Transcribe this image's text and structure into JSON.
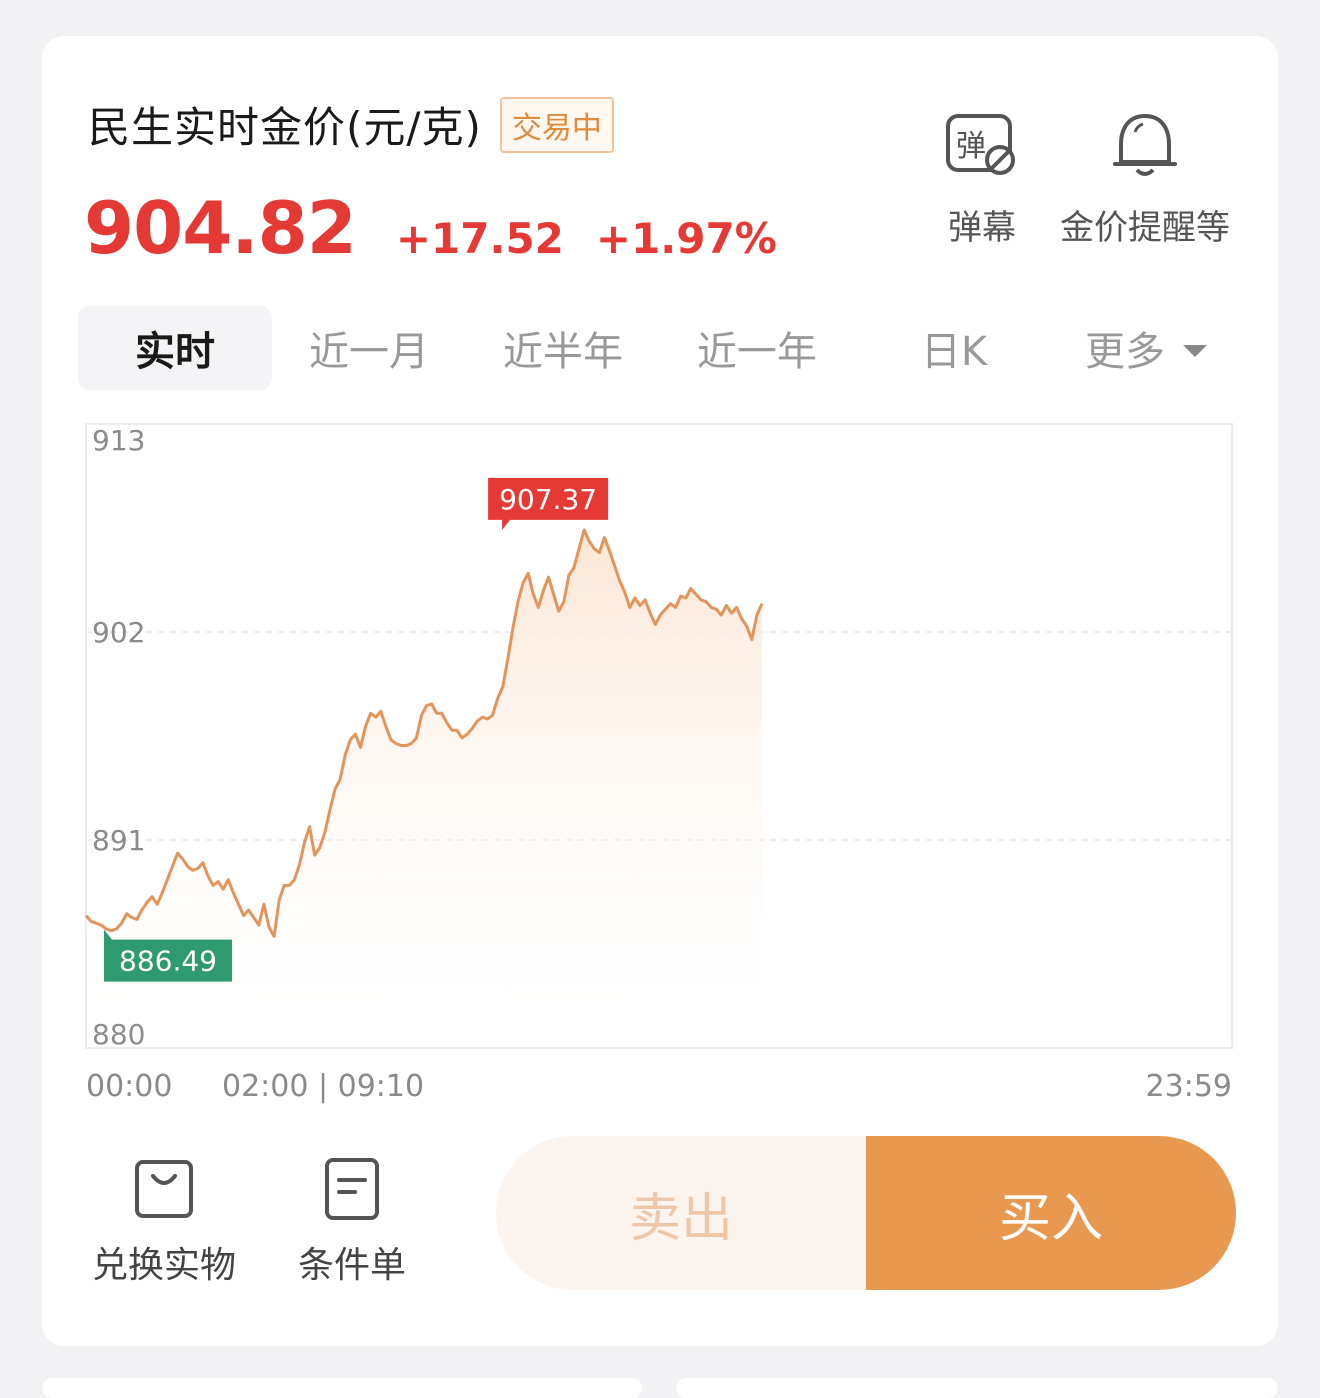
{
  "header": {
    "title": "民生实时金价(元/克)",
    "status_badge": "交易中",
    "price": "904.82",
    "change": "+17.52",
    "change_pct": "+1.97%"
  },
  "tools": {
    "danmu_icon_text": "弹",
    "danmu_label": "弹幕",
    "alert_label": "金价提醒等"
  },
  "tabs": [
    {
      "label": "实时",
      "active": true
    },
    {
      "label": "近一月"
    },
    {
      "label": "近半年"
    },
    {
      "label": "近一年"
    },
    {
      "label": "日K"
    },
    {
      "label": "更多"
    }
  ],
  "chart_data": {
    "type": "line",
    "x_ticks": [
      "00:00",
      "02:00 | 09:10",
      "23:59"
    ],
    "y_ticks": [
      913,
      902,
      891,
      880
    ],
    "ylim": [
      880,
      913
    ],
    "series": [
      {
        "values": [
          887.0,
          886.7,
          886.6,
          886.5,
          886.3,
          886.2,
          886.3,
          886.6,
          887.1,
          886.9,
          886.8,
          887.3,
          887.7,
          888.0,
          887.6,
          888.2,
          888.9,
          889.6,
          890.3,
          890.0,
          889.6,
          889.4,
          889.5,
          889.8,
          889.1,
          888.6,
          888.8,
          888.4,
          888.9,
          888.2,
          887.6,
          887.0,
          887.3,
          886.9,
          886.5,
          887.6,
          886.4,
          885.9,
          887.8,
          888.6,
          888.6,
          888.9,
          889.7,
          890.9,
          891.7,
          890.2,
          890.6,
          891.4,
          892.6,
          893.7,
          894.2,
          895.5,
          896.3,
          896.6,
          895.9,
          897.0,
          897.7,
          897.5,
          897.8,
          897.0,
          896.3,
          896.1,
          896.0,
          896.0,
          896.1,
          896.4,
          897.6,
          898.1,
          898.2,
          897.7,
          897.7,
          897.2,
          896.8,
          896.8,
          896.4,
          896.6,
          896.9,
          897.3,
          897.5,
          897.4,
          897.6,
          898.5,
          899.1,
          900.6,
          902.2,
          903.6,
          904.6,
          905.1,
          904.0,
          903.3,
          904.2,
          904.9,
          904.0,
          903.1,
          903.6,
          905.0,
          905.4,
          906.4,
          907.4,
          906.8,
          906.4,
          906.2,
          907.0,
          906.3,
          905.5,
          904.7,
          904.1,
          903.3,
          903.8,
          903.4,
          903.7,
          903.0,
          902.4,
          902.9,
          903.2,
          903.5,
          903.3,
          903.9,
          903.8,
          904.3,
          904.0,
          903.7,
          903.6,
          903.3,
          903.2,
          902.9,
          903.4,
          903.0,
          903.3,
          902.7,
          902.3,
          901.6,
          902.9,
          903.5
        ]
      }
    ],
    "max_label": "907.37",
    "min_label": "886.49",
    "grid": true,
    "color_line": "#e4935a",
    "color_max": "#e53935",
    "color_min": "#2e9a6f"
  },
  "actions": {
    "exchange_label": "兑换实物",
    "conditional_label": "条件单",
    "sell_label": "卖出",
    "buy_label": "买入"
  },
  "colors": {
    "up": "#e53935",
    "accent": "#e9984f",
    "badge": "#e08a3c"
  }
}
